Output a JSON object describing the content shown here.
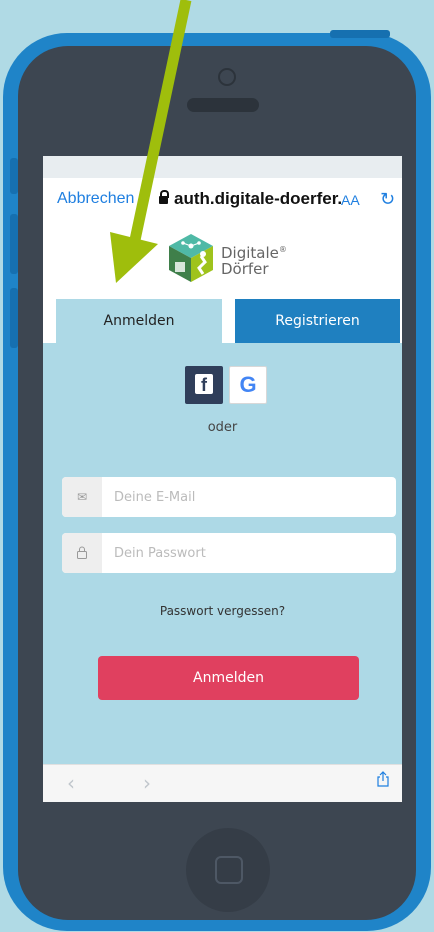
{
  "colors": {
    "background": "#b0dae5",
    "phone_frame": "#1f84c8",
    "phone_body": "#3d4651",
    "arrow": "#9fbe0c",
    "link_blue": "#1f7fe0",
    "tab_active_bg": "#add9e6",
    "tab_inactive_bg": "#1f80c0",
    "login_button": "#e0405f"
  },
  "statusbar": {
    "carrier": "",
    "time": "",
    "battery": ""
  },
  "navbar": {
    "cancel_label": "Abbrechen",
    "url": "auth.digitale-doerfer.de",
    "text_size_label": "AA",
    "reload_icon": "reload-icon"
  },
  "logo": {
    "line1": "Digitale",
    "line2": "Dörfer",
    "mark": "®"
  },
  "tabs": {
    "login": "Anmelden",
    "register": "Registrieren"
  },
  "social": {
    "facebook": "f",
    "google": "G"
  },
  "or_label": "oder",
  "email": {
    "placeholder": "Deine E-Mail",
    "value": ""
  },
  "password": {
    "placeholder": "Dein Passwort",
    "value": ""
  },
  "forgot_label": "Passwort vergessen?",
  "login_button": "Anmelden",
  "toolbar": {
    "back": "‹",
    "forward": "›"
  }
}
